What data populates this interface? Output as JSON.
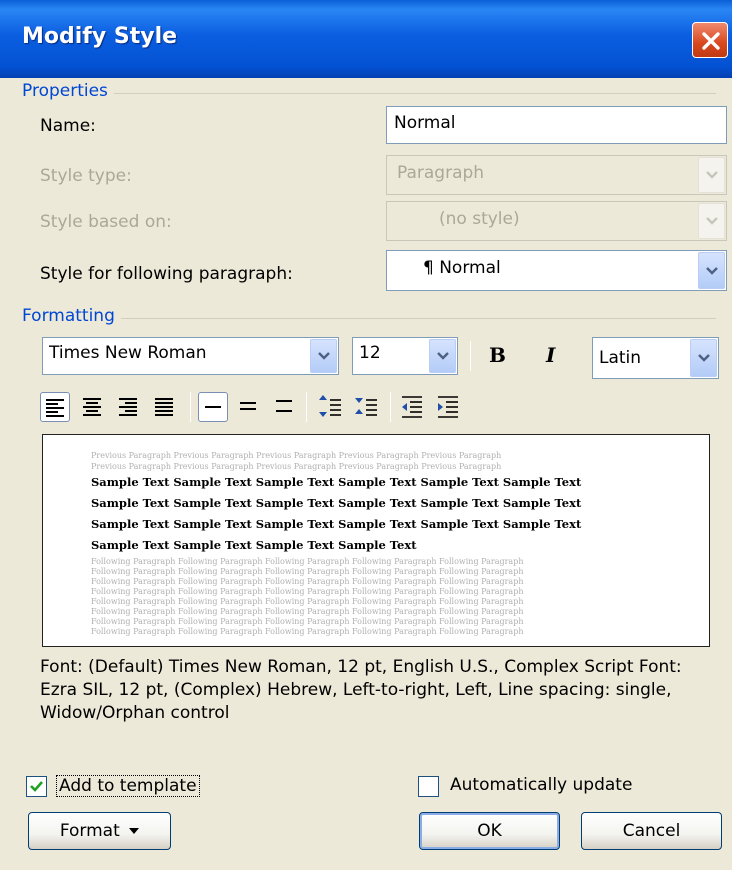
{
  "dialog": {
    "title": "Modify Style"
  },
  "properties": {
    "heading": "Properties",
    "name_label": "Name:",
    "name_value": "Normal",
    "style_type_label": "Style type:",
    "style_type_value": "Paragraph",
    "based_on_label": "Style based on:",
    "based_on_value": "(no style)",
    "following_label": "Style for following paragraph:",
    "following_value": "¶ Normal"
  },
  "formatting": {
    "heading": "Formatting",
    "font_name": "Times New Roman",
    "font_size": "12",
    "bold_label": "B",
    "italic_label": "I",
    "script": "Latin"
  },
  "preview": {
    "previous_line": "Previous Paragraph Previous Paragraph Previous Paragraph Previous Paragraph Previous Paragraph",
    "sample_lines": [
      "Sample Text Sample Text Sample Text Sample Text Sample Text Sample Text",
      "Sample Text Sample Text Sample Text Sample Text Sample Text Sample Text",
      "Sample Text Sample Text Sample Text Sample Text Sample Text Sample Text",
      "Sample Text Sample Text Sample Text Sample Text"
    ],
    "following_line": "Following Paragraph Following Paragraph Following Paragraph Following Paragraph Following Paragraph"
  },
  "description": "Font: (Default) Times New Roman, 12 pt, English U.S., Complex Script Font: Ezra SIL, 12 pt, (Complex) Hebrew, Left-to-right, Left, Line spacing:  single, Widow/Orphan control",
  "options": {
    "add_to_template": "Add to template",
    "add_to_template_checked": true,
    "auto_update": "Automatically update",
    "auto_update_checked": false
  },
  "buttons": {
    "format": "Format",
    "ok": "OK",
    "cancel": "Cancel"
  },
  "colors": {
    "title_bar": "#0a5fd8",
    "group_heading": "#0046d5",
    "dialog_bg": "#ece9d8"
  }
}
